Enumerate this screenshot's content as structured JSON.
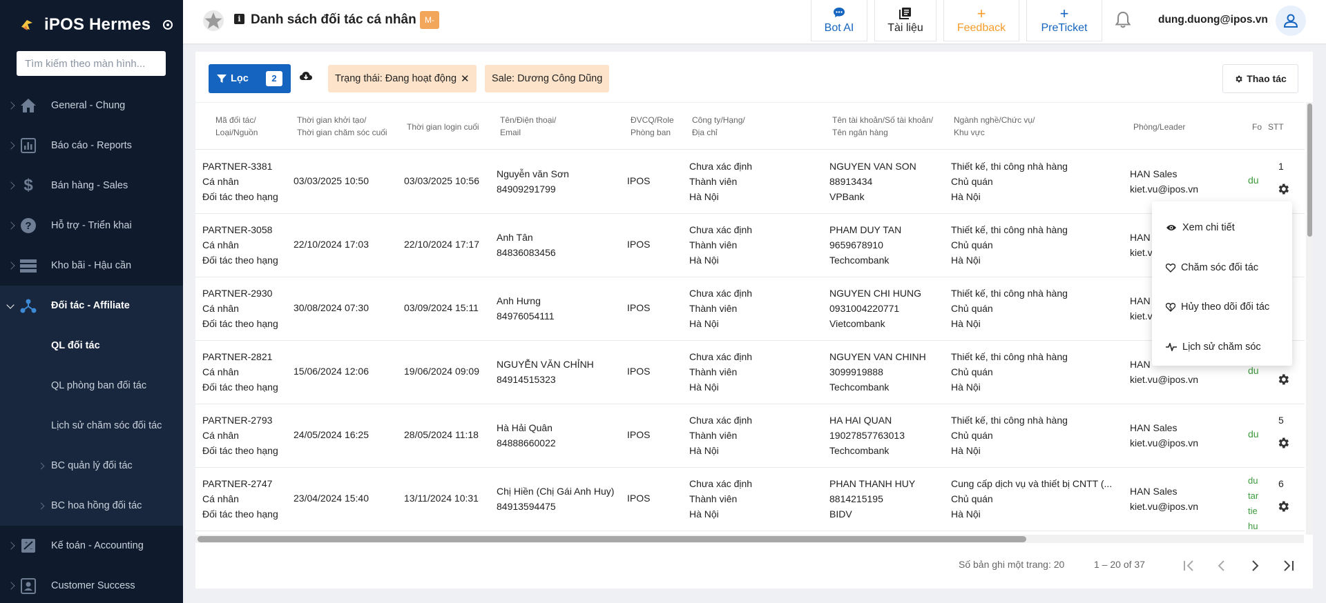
{
  "app": {
    "name": "iPOS Hermes"
  },
  "sidebar": {
    "search_placeholder": "Tìm kiếm theo màn hình...",
    "items": [
      {
        "label": "General - Chung",
        "icon": "home-icon"
      },
      {
        "label": "Báo cáo - Reports",
        "icon": "bar-chart-icon"
      },
      {
        "label": "Bán hàng - Sales",
        "icon": "dollar-icon"
      },
      {
        "label": "Hỗ trợ - Triển khai",
        "icon": "help-circle-icon"
      },
      {
        "label": "Kho bãi - Hậu cần",
        "icon": "storage-icon"
      },
      {
        "label": "Đối tác - Affiliate",
        "icon": "share-network-icon"
      }
    ],
    "sub_items": [
      {
        "label": "QL đối tác"
      },
      {
        "label": "QL phòng ban đối tác"
      },
      {
        "label": "Lịch sử chăm sóc đối tác"
      },
      {
        "label": "BC quản lý đối tác"
      },
      {
        "label": "BC hoa hồng đối tác"
      }
    ],
    "bottom_items": [
      {
        "label": "Kế toán - Accounting",
        "icon": "accounting-icon"
      },
      {
        "label": "Customer Success",
        "icon": "contact-card-icon"
      }
    ]
  },
  "header": {
    "title": "Danh sách đối tác cá nhân",
    "badge": "M-",
    "buttons": [
      {
        "label": "Bot AI",
        "icon": "chat-icon",
        "color": "#1565c0"
      },
      {
        "label": "Tài liệu",
        "icon": "book-icon",
        "color": "#222222"
      },
      {
        "label": "Feedback",
        "icon": "plus-icon",
        "color": "#f59c2a"
      },
      {
        "label": "PreTicket",
        "icon": "plus-icon",
        "color": "#1565c0"
      }
    ],
    "user_email": "dung.duong@ipos.vn"
  },
  "filters": {
    "filter_button": "Lọc",
    "filter_count": "2",
    "chips": [
      {
        "label": "Trạng thái: Đang hoạt động",
        "removable": true
      },
      {
        "label": "Sale: Dương Công Dũng",
        "removable": false
      }
    ],
    "action_button": "Thao tác"
  },
  "table": {
    "headers": {
      "code": [
        "Mã đối tác/",
        "Loại/Nguồn"
      ],
      "created": [
        "Thời gian khởi tạo/",
        "Thời gian chăm sóc cuối"
      ],
      "last_login": [
        "Thời gian login cuối"
      ],
      "name": [
        "Tên/Điện thoại/",
        "Email"
      ],
      "unit": [
        "ĐVCQ/Role",
        "Phòng ban"
      ],
      "company": [
        "Công ty/Hạng/",
        "Địa chỉ"
      ],
      "bank": [
        "Tên tài khoản/Số tài khoản/",
        "Tên ngân hàng"
      ],
      "industry": [
        "Ngành nghề/Chức vụ/",
        "Khu vực"
      ],
      "dept": [
        "Phòng/Leader"
      ],
      "fo": [
        "Fo"
      ],
      "stt": [
        "STT"
      ]
    },
    "rows": [
      {
        "code": "PARTNER-3381",
        "type": "Cá nhân",
        "source": "Đối tác theo hạng",
        "created": "03/03/2025 10:50",
        "last_login": "03/03/2025 10:56",
        "name": "Nguyễn văn Sơn",
        "phone": "84909291799",
        "unit": "IPOS",
        "company": "Chưa xác định",
        "rank": "Thành viên",
        "address": "Hà Nội",
        "acc_name": "NGUYEN VAN SON",
        "acc_no": "88913434",
        "bank": "VPBank",
        "industry": "Thiết kế, thi công nhà hàng",
        "position": "Chủ quán",
        "region": "Hà Nội",
        "dept": "HAN Sales",
        "leader": "kiet.vu@ipos.vn",
        "fo": "du",
        "stt": "1"
      },
      {
        "code": "PARTNER-3058",
        "type": "Cá nhân",
        "source": "Đối tác theo hạng",
        "created": "22/10/2024 17:03",
        "last_login": "22/10/2024 17:17",
        "name": "Anh Tân",
        "phone": "84836083456",
        "unit": "IPOS",
        "company": "Chưa xác định",
        "rank": "Thành viên",
        "address": "Hà Nội",
        "acc_name": "PHAM DUY TAN",
        "acc_no": "9659678910",
        "bank": "Techcombank",
        "industry": "Thiết kế, thi công nhà hàng",
        "position": "Chủ quán",
        "region": "Hà Nội",
        "dept": "HAN",
        "leader": "kiet.v",
        "fo": "",
        "stt": ""
      },
      {
        "code": "PARTNER-2930",
        "type": "Cá nhân",
        "source": "Đối tác theo hạng",
        "created": "30/08/2024 07:30",
        "last_login": "03/09/2024 15:11",
        "name": "Anh Hưng",
        "phone": "84976054111",
        "unit": "IPOS",
        "company": "Chưa xác định",
        "rank": "Thành viên",
        "address": "Hà Nội",
        "acc_name": "NGUYEN CHI HUNG",
        "acc_no": "0931004220771",
        "bank": "Vietcombank",
        "industry": "Thiết kế, thi công nhà hàng",
        "position": "Chủ quán",
        "region": "Hà Nội",
        "dept": "HAN",
        "leader": "kiet.v",
        "fo": "",
        "stt": ""
      },
      {
        "code": "PARTNER-2821",
        "type": "Cá nhân",
        "source": "Đối tác theo hạng",
        "created": "15/06/2024 12:06",
        "last_login": "19/06/2024 09:09",
        "name": "NGUYỄN VĂN CHỈNH",
        "phone": "84914515323",
        "unit": "IPOS",
        "company": "Chưa xác định",
        "rank": "Thành viên",
        "address": "Hà Nội",
        "acc_name": "NGUYEN VAN CHINH",
        "acc_no": "3099919888",
        "bank": "Techcombank",
        "industry": "Thiết kế, thi công nhà hàng",
        "position": "Chủ quán",
        "region": "Hà Nội",
        "dept": "HAN",
        "leader": "kiet.vu@ipos.vn",
        "fo": "du",
        "stt": ""
      },
      {
        "code": "PARTNER-2793",
        "type": "Cá nhân",
        "source": "Đối tác theo hạng",
        "created": "24/05/2024 16:25",
        "last_login": "28/05/2024 11:18",
        "name": "Hà Hải Quân",
        "phone": "84888660022",
        "unit": "IPOS",
        "company": "Chưa xác định",
        "rank": "Thành viên",
        "address": "Hà Nội",
        "acc_name": "HA HAI QUAN",
        "acc_no": "19027857763013",
        "bank": "Techcombank",
        "industry": "Thiết kế, thi công nhà hàng",
        "position": "Chủ quán",
        "region": "Hà Nội",
        "dept": "HAN Sales",
        "leader": "kiet.vu@ipos.vn",
        "fo": "du",
        "stt": "5"
      },
      {
        "code": "PARTNER-2747",
        "type": "Cá nhân",
        "source": "Đối tác theo hạng",
        "created": "23/04/2024 15:40",
        "last_login": "13/11/2024 10:31",
        "name": "Chị Hiền (Chị Gái Anh Huy)",
        "phone": "84913594475",
        "unit": "IPOS",
        "company": "Chưa xác định",
        "rank": "Thành viên",
        "address": "Hà Nội",
        "acc_name": "PHAN THANH HUY",
        "acc_no": "8814215195",
        "bank": "BIDV",
        "industry": "Cung cấp dịch vụ và thiết bị CNTT (...",
        "position": "Chủ quán",
        "region": "Hà Nội",
        "dept": "HAN Sales",
        "leader": "kiet.vu@ipos.vn",
        "fo_lines": [
          "du",
          "tar",
          "tie",
          "hu"
        ],
        "stt": "6"
      }
    ]
  },
  "pagination": {
    "per_page_label": "Số bản ghi một trang: 20",
    "range": "1 – 20 of 37"
  },
  "context_menu": {
    "items": [
      {
        "label": "Xem chi tiết",
        "icon": "eye-icon"
      },
      {
        "label": "Chăm sóc đối tác",
        "icon": "heart-icon"
      },
      {
        "label": "Hủy theo dõi đối tác",
        "icon": "heart-broken-icon"
      },
      {
        "label": "Lịch sử chăm sóc",
        "icon": "activity-icon"
      }
    ]
  }
}
